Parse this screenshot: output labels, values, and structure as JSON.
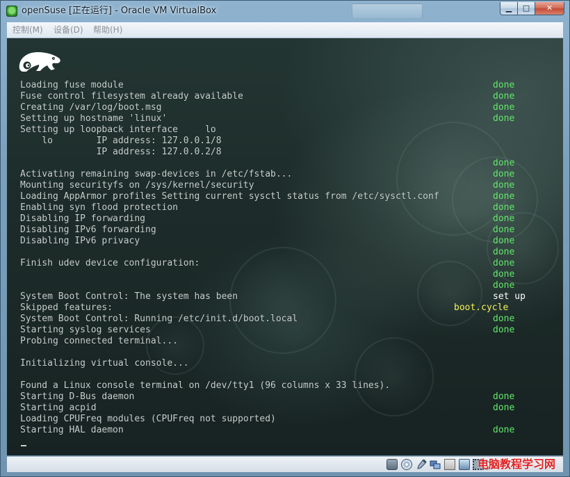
{
  "window": {
    "title": "openSuse [正在运行] - Oracle VM VirtualBox",
    "min_label": "▁",
    "max_label": "□",
    "close_label": "✕"
  },
  "menu": {
    "items": [
      {
        "label": "控制(M)"
      },
      {
        "label": "设备(D)"
      },
      {
        "label": "帮助(H)"
      }
    ]
  },
  "console": {
    "lines": [
      {
        "text": "Loading fuse module",
        "status": "done"
      },
      {
        "text": "Fuse control filesystem already available",
        "status": "done"
      },
      {
        "text": "Creating /var/log/boot.msg",
        "status": "done"
      },
      {
        "text": "Setting up hostname 'linux'",
        "status": "done"
      },
      {
        "text": "Setting up loopback interface     lo",
        "status": ""
      },
      {
        "text": "    lo        IP address: 127.0.0.1/8",
        "status": ""
      },
      {
        "text": "              IP address: 127.0.0.2/8",
        "status": ""
      },
      {
        "text": "",
        "status": "done"
      },
      {
        "text": "Activating remaining swap-devices in /etc/fstab...",
        "status": "done"
      },
      {
        "text": "Mounting securityfs on /sys/kernel/security",
        "status": "done"
      },
      {
        "text": "Loading AppArmor profiles Setting current sysctl status from /etc/sysctl.conf",
        "status": "done"
      },
      {
        "text": "Enabling syn flood protection",
        "status": "done"
      },
      {
        "text": "Disabling IP forwarding",
        "status": "done"
      },
      {
        "text": "Disabling IPv6 forwarding",
        "status": "done"
      },
      {
        "text": "Disabling IPv6 privacy",
        "status": "done"
      },
      {
        "text": "",
        "status": "done"
      },
      {
        "text": "Finish udev device configuration:",
        "status": "done"
      },
      {
        "text": "",
        "status": "done"
      },
      {
        "text": "",
        "status": "done"
      },
      {
        "text": "System Boot Control: The system has been",
        "status": "set up"
      },
      {
        "text": "Skipped features:",
        "status": "boot.cycle"
      },
      {
        "text": "System Boot Control: Running /etc/init.d/boot.local",
        "status": "done"
      },
      {
        "text": "Starting syslog services",
        "status": "done"
      },
      {
        "text": "Probing connected terminal...",
        "status": ""
      },
      {
        "text": "",
        "status": ""
      },
      {
        "text": "Initializing virtual console...",
        "status": ""
      },
      {
        "text": "",
        "status": ""
      },
      {
        "text": "Found a Linux console terminal on /dev/tty1 (96 columns x 33 lines).",
        "status": ""
      },
      {
        "text": "Starting D-Bus daemon",
        "status": "done"
      },
      {
        "text": "Starting acpid",
        "status": "done"
      },
      {
        "text": "Loading CPUFreq modules (CPUFreq not supported)",
        "status": ""
      },
      {
        "text": "Starting HAL daemon",
        "status": "done"
      }
    ],
    "cursor": "_"
  },
  "colors": {
    "done": "#62e86a",
    "set_up": "#ffffff",
    "boot_cycle": "#f2f25a",
    "console_text": "#c9d2cf"
  },
  "statusbar": {
    "icons": [
      "hard-disk-icon",
      "optical-drive-icon",
      "usb-icon",
      "shared-folders-icon",
      "network-icon",
      "display-icon",
      "cpu-icon",
      "mouse-integration-icon"
    ]
  },
  "watermark": "电脑教程学习网"
}
